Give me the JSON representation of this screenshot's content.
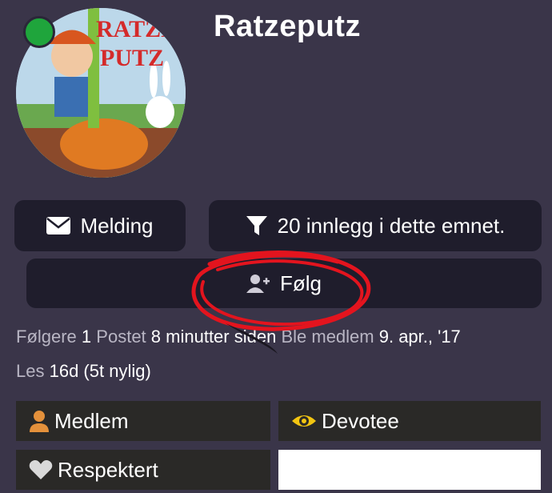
{
  "profile": {
    "username": "Ratzeputz",
    "avatar_text_line1": "RATZE",
    "avatar_text_line2": "PUTZ",
    "online_status_color": "#1fa53c"
  },
  "actions": {
    "message_label": "Melding",
    "filter_label": "20 innlegg i dette emnet.",
    "follow_label": "Følg"
  },
  "stats": {
    "followers_label": "Følgere",
    "followers_value": "1",
    "posted_label": "Postet",
    "posted_value": "8 minutter siden",
    "member_label": "Ble medlem",
    "member_value": "9. apr., '17",
    "read_label": "Les",
    "read_value": "16d (5t nylig)"
  },
  "groups": [
    {
      "label": "Medlem",
      "icon": "person-icon",
      "color": "#e4913b"
    },
    {
      "label": "Devotee",
      "icon": "eye-icon",
      "color": "#f2c511"
    },
    {
      "label": "Respektert",
      "icon": "heart-icon",
      "color": "#d9d9d9"
    }
  ],
  "colors": {
    "background": "#3a3549",
    "button_bg": "#1f1d2c",
    "annotation_red": "#e3141e"
  }
}
